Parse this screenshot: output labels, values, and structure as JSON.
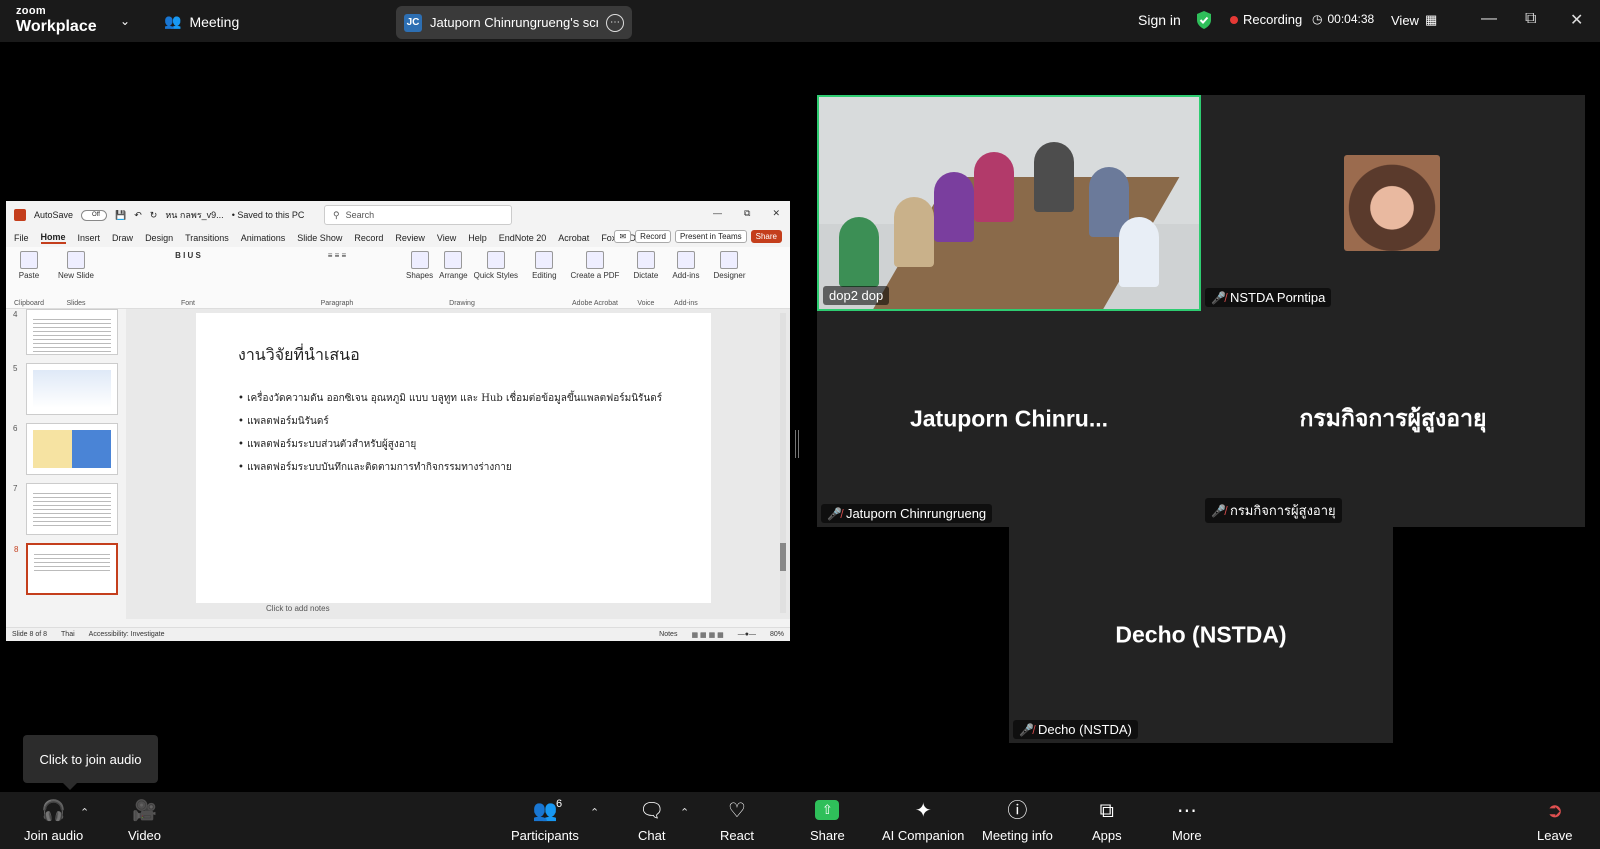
{
  "topbar": {
    "logo_line1": "zoom",
    "logo_line2": "Workplace",
    "meeting_label": "Meeting",
    "share_initials": "JC",
    "share_title": "Jatuporn Chinrungrueng's screen",
    "sign_in": "Sign in",
    "recording": "Recording",
    "timer": "00:04:38",
    "view": "View"
  },
  "ppt": {
    "autosave": "AutoSave",
    "autosave_state": "Off",
    "filename": "หน กลพร_v9...",
    "saved_status": "• Saved to this PC",
    "search_placeholder": "Search",
    "tabs": [
      "File",
      "Home",
      "Insert",
      "Draw",
      "Design",
      "Transitions",
      "Animations",
      "Slide Show",
      "Record",
      "Review",
      "View",
      "Help",
      "EndNote 20",
      "Acrobat",
      "Foxit PDF"
    ],
    "record_btn": "Record",
    "present_btn": "Present in Teams",
    "share_btn": "Share",
    "ribbon_groups": {
      "clipboard": "Clipboard",
      "paste": "Paste",
      "slides": "Slides",
      "new_slide": "New Slide",
      "font": "Font",
      "paragraph": "Paragraph",
      "drawing": "Drawing",
      "shapes": "Shapes",
      "arrange": "Arrange",
      "quick_styles": "Quick Styles",
      "editing": "Editing",
      "create_pdf": "Create a PDF",
      "adobe": "Adobe Acrobat",
      "dictate": "Dictate",
      "voice": "Voice",
      "addins": "Add-ins",
      "addins_group": "Add-ins",
      "designer": "Designer"
    },
    "thumb_numbers": [
      "4",
      "5",
      "6",
      "7",
      "8"
    ],
    "slide_title": "งานวิจัยที่นำเสนอ",
    "bullets": [
      "เครื่องวัดความดัน ออกซิเจน อุณหภูมิ แบบ บลูทูท และ Hub เชื่อมต่อข้อมูลขึ้นแพลตฟอร์มนิรันดร์",
      "แพลตฟอร์มนิรันดร์",
      "แพลตฟอร์มระบบส่วนตัวสำหรับผู้สูงอายุ",
      "แพลตฟอร์มระบบบันทึกและติดตามการทำกิจกรรมทางร่างกาย"
    ],
    "notes_placeholder": "Click to add notes",
    "status": {
      "slide_count": "Slide 8 of 8",
      "language": "Thai",
      "accessibility": "Accessibility: Investigate",
      "notes": "Notes",
      "zoom": "80%"
    }
  },
  "tiles": [
    {
      "name": "dop2 dop",
      "muted": false
    },
    {
      "name": "NSTDA Porntipa",
      "muted": true
    },
    {
      "name": "Jatuporn Chinrungrueng",
      "display": "Jatuporn  Chinru...",
      "muted": true
    },
    {
      "name": "กรมกิจการผู้สูงอายุ",
      "display": "กรมกิจการผู้สูงอายุ",
      "muted": true
    },
    {
      "name": "Decho (NSTDA)",
      "display": "Decho (NSTDA)",
      "muted": true
    }
  ],
  "tooltip": "Click to join audio",
  "bottombar": {
    "join_audio": "Join audio",
    "video": "Video",
    "participants": "Participants",
    "participants_count": "6",
    "chat": "Chat",
    "react": "React",
    "share": "Share",
    "ai_companion": "AI Companion",
    "meeting_info": "Meeting info",
    "apps": "Apps",
    "more": "More",
    "leave": "Leave"
  },
  "colors": {
    "active_speaker_border": "#2ecc71",
    "recording_dot": "#e53935",
    "share_green": "#2fbf5a",
    "ppt_accent": "#c43e1c",
    "mute_red": "#e05050"
  }
}
